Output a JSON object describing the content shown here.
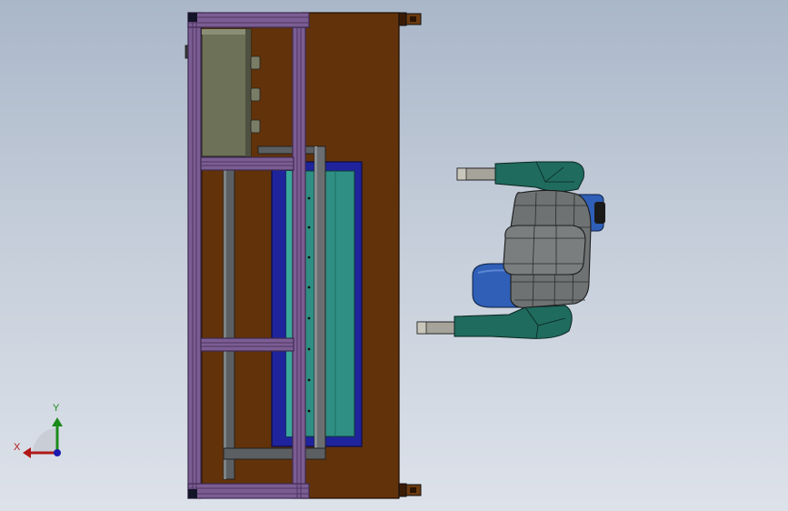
{
  "viewport": {
    "background_top": "#aab7c9",
    "background_bottom": "#dde2ea"
  },
  "triad": {
    "x_label": "X",
    "y_label": "Y",
    "x_color": "#b01818",
    "y_color": "#1a8a1a",
    "z_color": "#1a1ab0"
  },
  "colors": {
    "wood_panel": "#62320a",
    "aluminum_frame": "#7b5d93",
    "frame_edge": "#3d2950",
    "control_box": "#6d7158",
    "steel_rail": "#5b5f61",
    "blue_tray": "#1f249c",
    "teal_bed": "#2f8f84",
    "robot_teal": "#1f6b5e",
    "robot_gray": "#6f7273",
    "motor_blue": "#2f5fb6"
  }
}
